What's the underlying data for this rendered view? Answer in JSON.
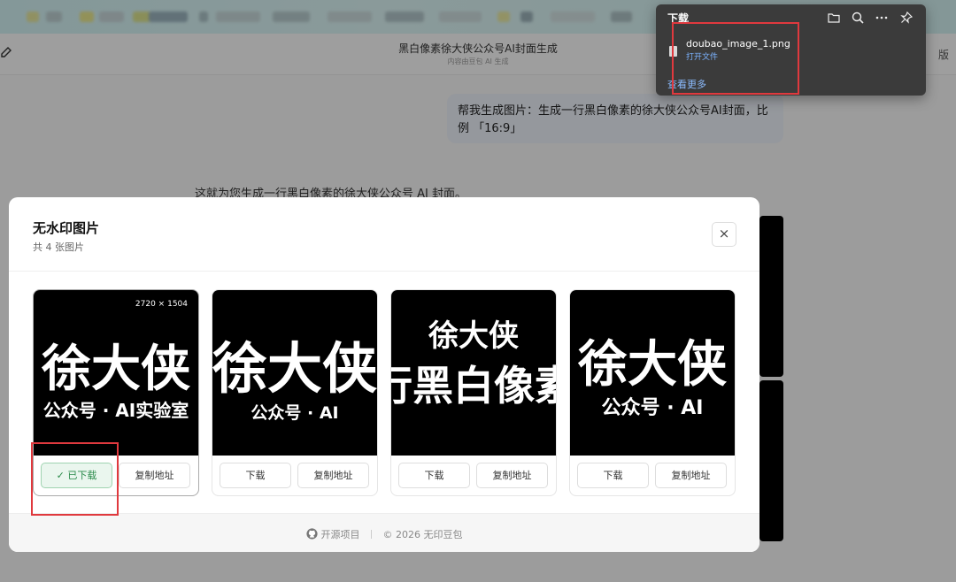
{
  "browser": {
    "chip_colors": [
      "#e6e18c",
      "#b7c7c9",
      "#e8e27a",
      "#c3cfd2",
      "#d9dd7b",
      "#8fa7b3",
      "#c2d1d3",
      "#a2b8bd",
      "#90a5ad",
      "#c8d6d8",
      "#b0c3c6",
      "#c6d4d6",
      "#a9bcc0",
      "#e8e492",
      "#a4b7bb",
      "#cfdbdc"
    ]
  },
  "chat": {
    "title": "黑白像素徐大侠公众号AI封面生成",
    "subtitle": "内容由豆包 AI 生成",
    "right_text": "版",
    "user_message": "帮我生成图片：生成一行黑白像素的徐大侠公众号AI封面，比例 「16:9」",
    "ai_message": "这就为您生成一行黑白像素的徐大侠公众号 AI 封面。"
  },
  "download_panel": {
    "title": "下载",
    "tools": [
      "folder-icon",
      "search-icon",
      "more-icon",
      "pin-icon"
    ],
    "filename": "doubao_image_1.png",
    "open_file": "打开文件",
    "see_more": "查看更多"
  },
  "modal": {
    "title": "无水印图片",
    "subtitle": "共 4 张图片",
    "close": "×",
    "cards": [
      {
        "dimensions": "2720 × 1504",
        "line1": "徐大侠",
        "line2": "公众号 · AI实验室",
        "download": "✓ 已下载",
        "copy": "复制地址",
        "downloaded": true
      },
      {
        "dimensions": "",
        "line1": "徐大侠",
        "line2": "公众号 · AI",
        "download": "下载",
        "copy": "复制地址",
        "downloaded": false
      },
      {
        "dimensions": "",
        "line1": "徐大侠",
        "line2": "行黑白像素",
        "download": "下载",
        "copy": "复制地址",
        "downloaded": false
      },
      {
        "dimensions": "",
        "line1": "徐大侠",
        "line2": "公众号 · AI",
        "download": "下载",
        "copy": "复制地址",
        "downloaded": false
      }
    ],
    "footer": {
      "open_source": "开源项目",
      "copyright": "© 2026 无印豆包"
    }
  },
  "colors": {
    "highlight_red": "#e0393e",
    "downloaded_green": "#2a8a4a",
    "link_blue": "#8cbcff"
  }
}
